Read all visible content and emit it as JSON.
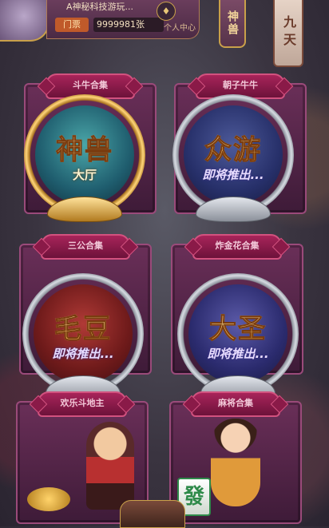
{
  "header": {
    "user_name": "A神秘科技游玩...",
    "ticket_label": "门票",
    "ticket_value": "9999981张",
    "center_link": "个人中心",
    "game_tag": "神兽",
    "room_tag": "九天"
  },
  "cards": [
    {
      "ribbon": "斗牛合集",
      "badge_title": "神兽",
      "badge_sub": "大厅"
    },
    {
      "ribbon": "朝子牛牛",
      "badge_title": "众游",
      "badge_sub": "即将推出..."
    },
    {
      "ribbon": "三公合集",
      "badge_title": "毛豆",
      "badge_sub": "即将推出..."
    },
    {
      "ribbon": "炸金花合集",
      "badge_title": "大圣",
      "badge_sub": "即将推出..."
    },
    {
      "ribbon": "欢乐斗地主"
    },
    {
      "ribbon": "麻将合集",
      "tile_text": "發"
    }
  ]
}
